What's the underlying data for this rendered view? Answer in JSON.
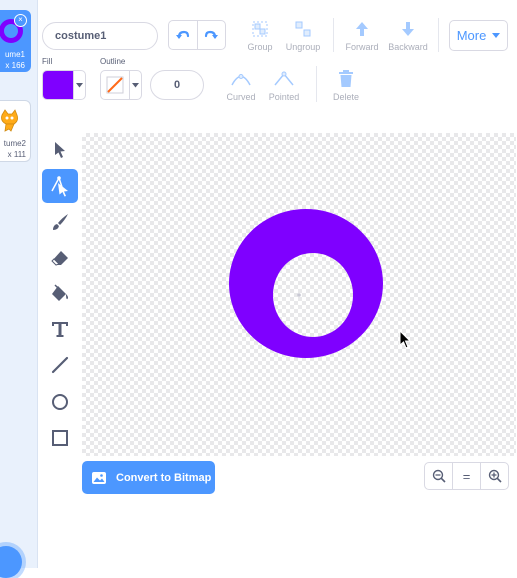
{
  "costumes": [
    {
      "name": "ume1",
      "size": "x 166",
      "selected": true,
      "thumb": "ring-icon"
    },
    {
      "name": "tume2",
      "size": "x 111",
      "selected": false,
      "thumb": "cat-sprite-icon"
    }
  ],
  "toolbar": {
    "costume_name": "costume1",
    "group_label": "Group",
    "ungroup_label": "Ungroup",
    "forward_label": "Forward",
    "backward_label": "Backward",
    "more_label": "More",
    "fill_label": "Fill",
    "outline_label": "Outline",
    "outline_width": "0",
    "curved_label": "Curved",
    "pointed_label": "Pointed",
    "delete_label": "Delete"
  },
  "colors": {
    "accent": "#4c97ff",
    "fill": "#7f00ff",
    "outline_none_slash": "#ff6a1a",
    "text": "#575e75"
  },
  "tools": [
    "select-icon",
    "reshape-icon",
    "brush-icon",
    "eraser-icon",
    "fill-bucket-icon",
    "text-icon",
    "line-icon",
    "circle-icon",
    "rectangle-icon"
  ],
  "bottom": {
    "convert_label": "Convert to Bitmap",
    "zoom_equal": "="
  }
}
